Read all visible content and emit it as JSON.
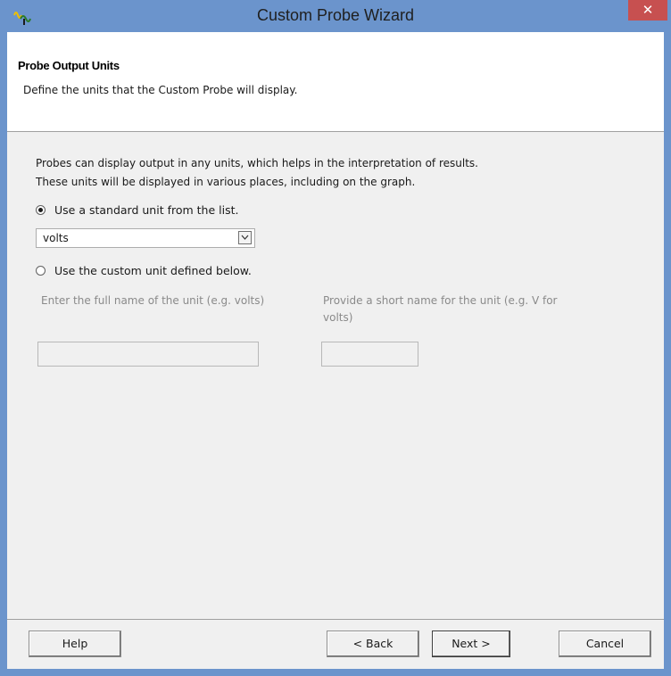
{
  "window": {
    "title": "Custom Probe Wizard",
    "close_glyph": "✕",
    "app_icon": "probe-wave-icon",
    "colors": {
      "titlebar": "#6b94cc",
      "close": "#c75050",
      "client": "#f0f0f0"
    }
  },
  "header": {
    "title": "Probe Output Units",
    "subtitle": "Define the units that the Custom Probe will display."
  },
  "body": {
    "description_line1": "Probes can display output in any units, which helps in the interpretation of results.",
    "description_line2": "These units will be displayed in various places, including on the graph.",
    "option_standard": {
      "label": "Use a standard unit from the list.",
      "checked": true
    },
    "unit_select": {
      "value": "volts"
    },
    "option_custom": {
      "label": "Use the custom unit defined below.",
      "checked": false
    },
    "full_name_label": "Enter the full name of the unit (e.g. volts)",
    "short_name_label_line1": "Provide a short name for the unit (e.g. V for",
    "short_name_label_line2": "volts)",
    "full_name_value": "",
    "short_name_value": ""
  },
  "footer": {
    "help": "Help",
    "back": "< Back",
    "next": "Next >",
    "cancel": "Cancel"
  }
}
